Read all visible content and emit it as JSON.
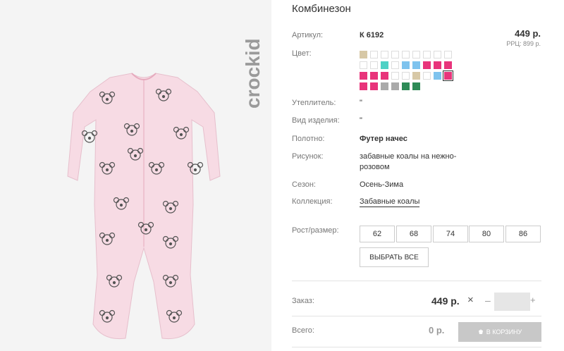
{
  "product": {
    "title": "Комбинезон",
    "brand": "crockid",
    "price": "449 р.",
    "rrp": "РРЦ: 899 р.",
    "garment_color": "#f7dbe4"
  },
  "specs": {
    "article_label": "Артикул:",
    "article_value": "К 6192",
    "color_label": "Цвет:",
    "insulation_label": "Утеплитель:",
    "insulation_value": "\"",
    "type_label": "Вид изделия:",
    "type_value": "\"",
    "fabric_label": "Полотно:",
    "fabric_value": "Футер начес",
    "print_label": "Рисунок:",
    "print_value_line1": "забавные коалы на нежно-",
    "print_value_line2": "розовом",
    "season_label": "Сезон:",
    "season_value": "Осень-Зима",
    "collection_label": "Коллекция:",
    "collection_value": "Забавные коалы"
  },
  "swatches": [
    [
      "#d7c8a6",
      "#ffffff",
      "#ffffff",
      "#ffffff",
      "#ffffff",
      "#ffffff",
      "#ffffff",
      "#ffffff",
      "#ffffff"
    ],
    [
      "#ffffff",
      "#ffffff",
      "#4fd1c5",
      "#ffffff",
      "#7ec3ee",
      "#7ec3ee",
      "#e8347b",
      "#e8347b",
      "#e8347b"
    ],
    [
      "#e8347b",
      "#e8347b",
      "#e8347b",
      "#ffffff",
      "#ffffff",
      "#d7c8a6",
      "#ffffff",
      "#7ec3ee",
      "#e8347b"
    ],
    [
      "#e8347b",
      "#e8347b",
      "#aaaaaa",
      "#aaaaaa",
      "#2e8b57",
      "#2e8b57"
    ]
  ],
  "sizes": {
    "label": "Рост/размер:",
    "values": [
      "62",
      "68",
      "74",
      "80",
      "86"
    ],
    "select_all": "ВЫБРАТЬ ВСЕ"
  },
  "order": {
    "label": "Заказ:",
    "price": "449 р.",
    "times": "×",
    "minus": "–",
    "plus": "+",
    "qty": "",
    "total_label": "Всего:",
    "total_value": "0 р.",
    "cart_label": "В КОРЗИНУ"
  }
}
